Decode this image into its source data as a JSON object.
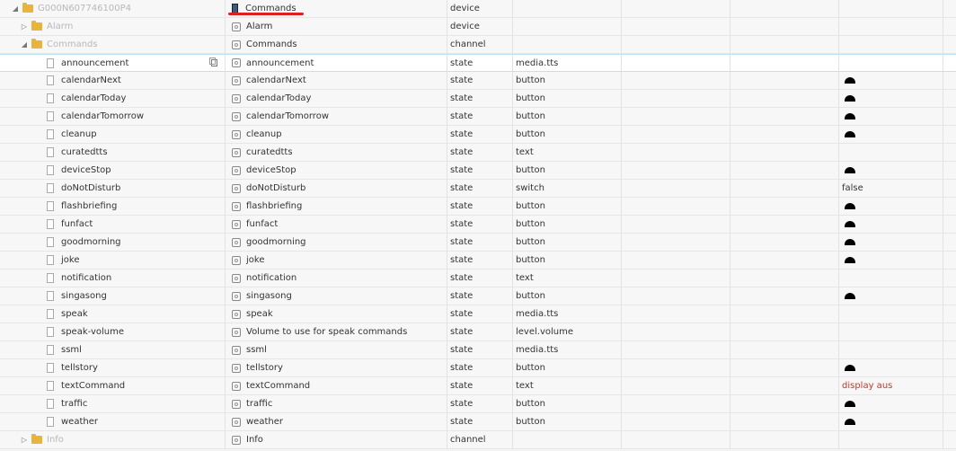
{
  "rows": [
    {
      "name": "G000N607746100P4",
      "name_grey": true,
      "indent": 22,
      "arrow": "◢",
      "icon": "folder",
      "col2": "Commands",
      "col2_icon": "device",
      "col3": "device",
      "col4": "",
      "col7": "",
      "col7_type": ""
    },
    {
      "name": "Alarm",
      "name_grey": true,
      "indent": 32,
      "arrow": "▷",
      "icon": "folder",
      "col2": "Alarm",
      "col2_icon": "role",
      "col3": "device",
      "col4": "",
      "col7": "",
      "col7_type": ""
    },
    {
      "name": "Commands",
      "name_grey": true,
      "indent": 32,
      "arrow": "◢",
      "icon": "folder",
      "col2": "Commands",
      "col2_icon": "role",
      "col3": "channel",
      "col4": "",
      "col7": "",
      "col7_type": ""
    },
    {
      "name": "announcement",
      "indent": 52,
      "icon": "file",
      "col2": "announcement",
      "col2_icon": "role",
      "col3": "state",
      "col4": "media.tts",
      "col7": "",
      "col7_type": "",
      "selected": true,
      "copy": true
    },
    {
      "name": "calendarNext",
      "indent": 52,
      "icon": "file",
      "col2": "calendarNext",
      "col2_icon": "role",
      "col3": "state",
      "col4": "button",
      "col7": "",
      "col7_type": "button"
    },
    {
      "name": "calendarToday",
      "indent": 52,
      "icon": "file",
      "col2": "calendarToday",
      "col2_icon": "role",
      "col3": "state",
      "col4": "button",
      "col7": "",
      "col7_type": "button"
    },
    {
      "name": "calendarTomorrow",
      "indent": 52,
      "icon": "file",
      "col2": "calendarTomorrow",
      "col2_icon": "role",
      "col3": "state",
      "col4": "button",
      "col7": "",
      "col7_type": "button"
    },
    {
      "name": "cleanup",
      "indent": 52,
      "icon": "file",
      "col2": "cleanup",
      "col2_icon": "role",
      "col3": "state",
      "col4": "button",
      "col7": "",
      "col7_type": "button"
    },
    {
      "name": "curatedtts",
      "indent": 52,
      "icon": "file",
      "col2": "curatedtts",
      "col2_icon": "role",
      "col3": "state",
      "col4": "text",
      "col7": "",
      "col7_type": ""
    },
    {
      "name": "deviceStop",
      "indent": 52,
      "icon": "file",
      "col2": "deviceStop",
      "col2_icon": "role",
      "col3": "state",
      "col4": "button",
      "col7": "",
      "col7_type": "button"
    },
    {
      "name": "doNotDisturb",
      "indent": 52,
      "icon": "file",
      "col2": "doNotDisturb",
      "col2_icon": "role",
      "col3": "state",
      "col4": "switch",
      "col7": "false",
      "col7_type": "text"
    },
    {
      "name": "flashbriefing",
      "indent": 52,
      "icon": "file",
      "col2": "flashbriefing",
      "col2_icon": "role",
      "col3": "state",
      "col4": "button",
      "col7": "",
      "col7_type": "button"
    },
    {
      "name": "funfact",
      "indent": 52,
      "icon": "file",
      "col2": "funfact",
      "col2_icon": "role",
      "col3": "state",
      "col4": "button",
      "col7": "",
      "col7_type": "button"
    },
    {
      "name": "goodmorning",
      "indent": 52,
      "icon": "file",
      "col2": "goodmorning",
      "col2_icon": "role",
      "col3": "state",
      "col4": "button",
      "col7": "",
      "col7_type": "button"
    },
    {
      "name": "joke",
      "indent": 52,
      "icon": "file",
      "col2": "joke",
      "col2_icon": "role",
      "col3": "state",
      "col4": "button",
      "col7": "",
      "col7_type": "button"
    },
    {
      "name": "notification",
      "indent": 52,
      "icon": "file",
      "col2": "notification",
      "col2_icon": "role",
      "col3": "state",
      "col4": "text",
      "col7": "",
      "col7_type": ""
    },
    {
      "name": "singasong",
      "indent": 52,
      "icon": "file",
      "col2": "singasong",
      "col2_icon": "role",
      "col3": "state",
      "col4": "button",
      "col7": "",
      "col7_type": "button"
    },
    {
      "name": "speak",
      "indent": 52,
      "icon": "file",
      "col2": "speak",
      "col2_icon": "role",
      "col3": "state",
      "col4": "media.tts",
      "col7": "",
      "col7_type": ""
    },
    {
      "name": "speak-volume",
      "indent": 52,
      "icon": "file",
      "col2": "Volume to use for speak commands",
      "col2_icon": "role",
      "col3": "state",
      "col4": "level.volume",
      "col7": "",
      "col7_type": ""
    },
    {
      "name": "ssml",
      "indent": 52,
      "icon": "file",
      "col2": "ssml",
      "col2_icon": "role",
      "col3": "state",
      "col4": "media.tts",
      "col7": "",
      "col7_type": ""
    },
    {
      "name": "tellstory",
      "indent": 52,
      "icon": "file",
      "col2": "tellstory",
      "col2_icon": "role",
      "col3": "state",
      "col4": "button",
      "col7": "",
      "col7_type": "button"
    },
    {
      "name": "textCommand",
      "indent": 52,
      "icon": "file",
      "col2": "textCommand",
      "col2_icon": "role",
      "col3": "state",
      "col4": "text",
      "col7": "display aus",
      "col7_type": "red"
    },
    {
      "name": "traffic",
      "indent": 52,
      "icon": "file",
      "col2": "traffic",
      "col2_icon": "role",
      "col3": "state",
      "col4": "button",
      "col7": "",
      "col7_type": "button"
    },
    {
      "name": "weather",
      "indent": 52,
      "icon": "file",
      "col2": "weather",
      "col2_icon": "role",
      "col3": "state",
      "col4": "button",
      "col7": "",
      "col7_type": "button"
    },
    {
      "name": "Info",
      "name_grey": true,
      "indent": 32,
      "arrow": "▷",
      "icon": "folder",
      "col2": "Info",
      "col2_icon": "role",
      "col3": "channel",
      "col4": "",
      "col7": "",
      "col7_type": ""
    }
  ]
}
